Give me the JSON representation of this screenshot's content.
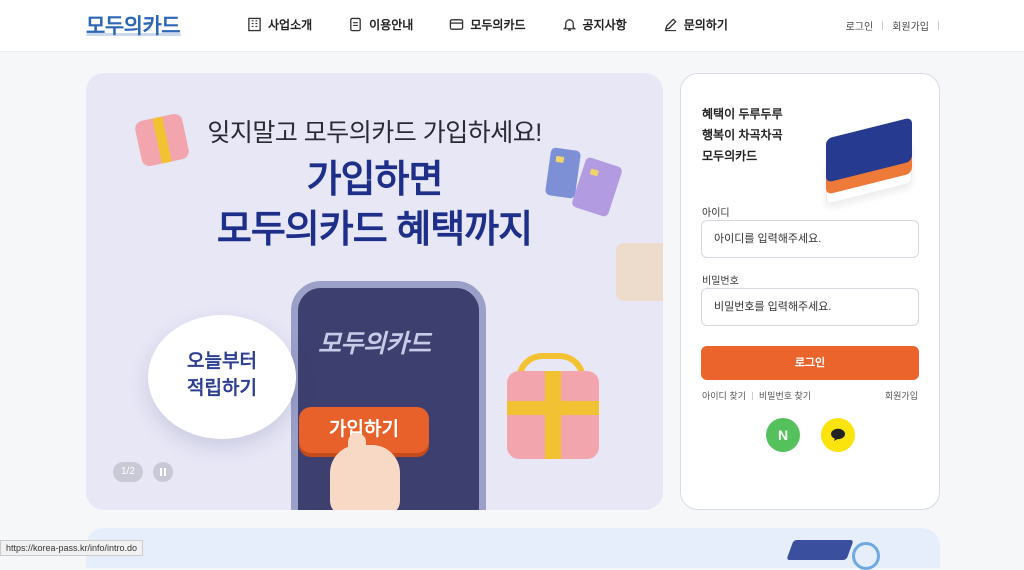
{
  "header": {
    "logo": "모두의카드",
    "nav": [
      {
        "label": "사업소개",
        "icon": "building-icon"
      },
      {
        "label": "이용안내",
        "icon": "document-icon"
      },
      {
        "label": "모두의카드",
        "icon": "card-icon"
      },
      {
        "label": "공지사항",
        "icon": "bell-icon"
      },
      {
        "label": "문의하기",
        "icon": "pencil-icon"
      }
    ],
    "util": {
      "login": "로그인",
      "signup": "회원가입"
    }
  },
  "banner": {
    "subtitle": "잊지말고 모두의카드 가입하세요!",
    "title_line1": "가입하면",
    "title_line2": "모두의카드 혜택까지",
    "phone_logo": "모두의카드",
    "bubble_line1": "오늘부터",
    "bubble_line2": "적립하기",
    "join_button": "가입하기",
    "pager": "1/2"
  },
  "login": {
    "heading_line1": "혜택이 두루두루",
    "heading_line2": "행복이 차곡차곡",
    "heading_line3": "모두의카드",
    "id_label": "아이디",
    "id_placeholder": "아이디를 입력해주세요.",
    "pw_label": "비밀번호",
    "pw_placeholder": "비밀번호를 입력해주세요.",
    "login_button": "로그인",
    "find_id": "아이디 찾기",
    "find_pw": "비밀번호 찾기",
    "signup": "회원가입",
    "naver_label": "N"
  },
  "status_url": "https://korea-pass.kr/info/intro.do",
  "colors": {
    "brand": "#2d67b8",
    "accent": "#ea642c",
    "navy": "#1e2f8a"
  }
}
